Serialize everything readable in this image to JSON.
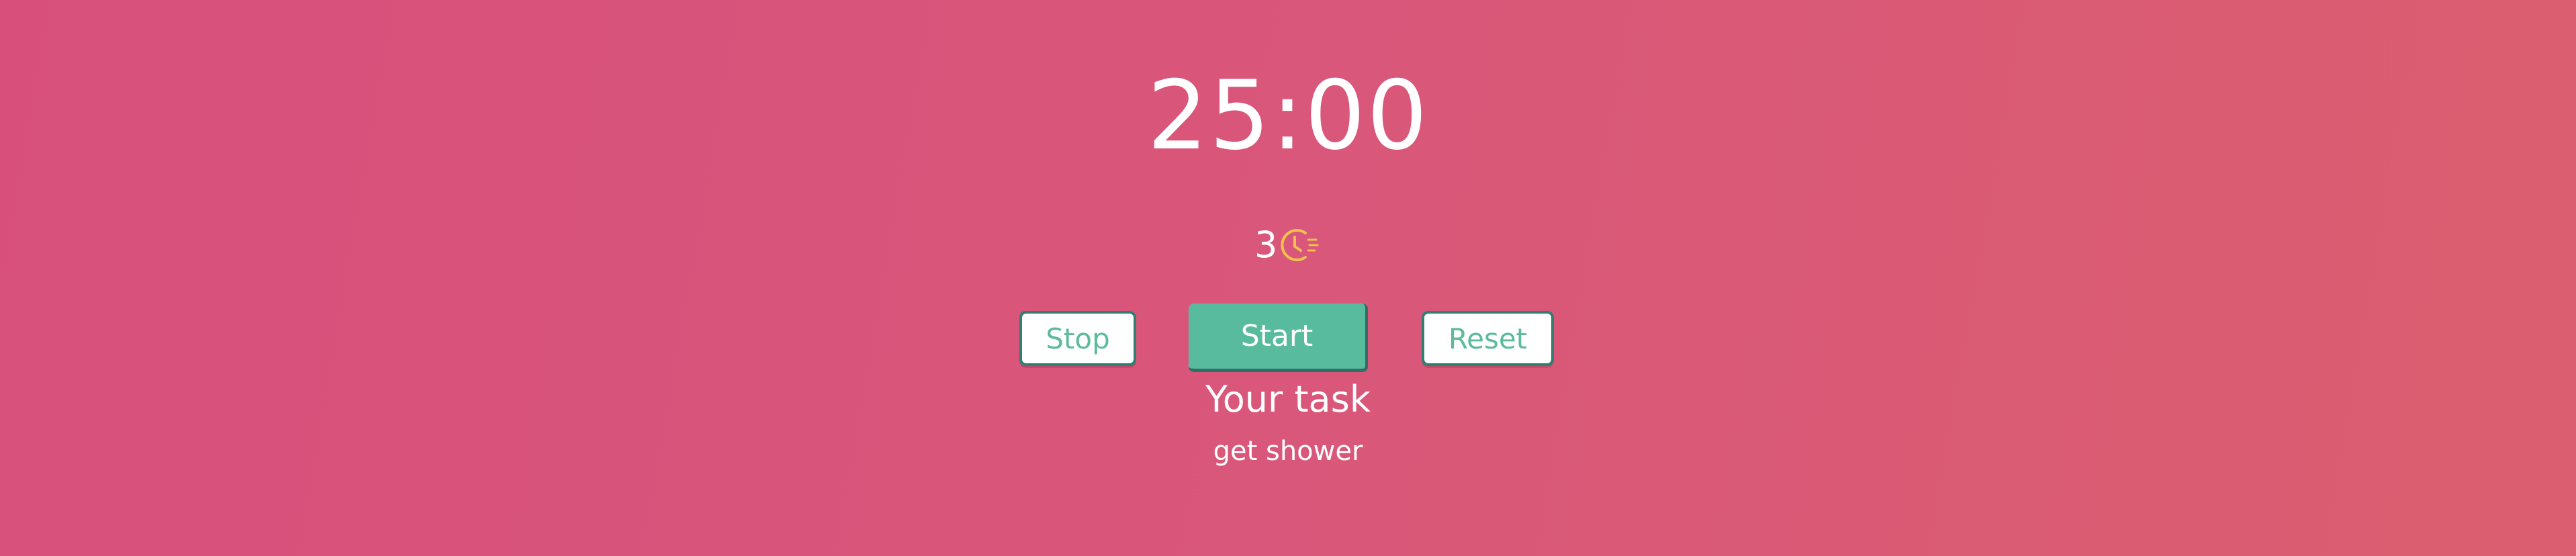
{
  "timer": {
    "display": "25:00"
  },
  "session_counter": {
    "value": "3",
    "icon": "fast-clock-icon"
  },
  "controls": {
    "stop_label": "Stop",
    "start_label": "Start",
    "reset_label": "Reset"
  },
  "task": {
    "heading": "Your task",
    "name": "get shower"
  },
  "colors": {
    "background_start": "#d84f7c",
    "background_end": "#da5e6f",
    "accent_green": "#58bb9d",
    "button_border": "#2f7f73",
    "icon_yellow": "#f2c14e",
    "text": "#ffffff"
  }
}
